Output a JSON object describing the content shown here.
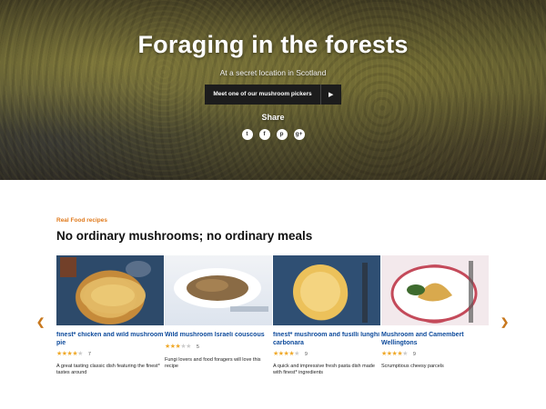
{
  "hero": {
    "title": "Foraging in the forests",
    "subtitle": "At a secret location in Scotland",
    "cta_label": "Meet one of our mushroom pickers",
    "cta_icon": "play-icon",
    "share_label": "Share",
    "share_icons": [
      "twitter-icon",
      "facebook-icon",
      "pinterest-icon",
      "google-plus-icon"
    ]
  },
  "recipes": {
    "eyebrow": "Real Food recipes",
    "title": "No ordinary mushrooms; no ordinary meals",
    "prev_icon": "chevron-left-icon",
    "next_icon": "chevron-right-icon",
    "items": [
      {
        "title": "finest* chicken and wild mushroom pie",
        "rating": 4,
        "rating_count": "7",
        "description": "A great tasting classic dish featuring the finest* tastes around"
      },
      {
        "title": "Wild mushroom Israeli couscous",
        "rating": 3,
        "rating_count": "5",
        "description": "Fungi lovers and food foragers will love this recipe"
      },
      {
        "title": "finest* mushroom and fusilli lunghi carbonara",
        "rating": 4,
        "rating_count": "9",
        "description": "A quick and impressive fresh pasta dish made with finest* ingredients"
      },
      {
        "title": "Mushroom and Camembert Wellingtons",
        "rating": 4,
        "rating_count": "9",
        "description": "Scrumptious cheesy parcels"
      }
    ]
  },
  "colors": {
    "accent": "#e07a1c",
    "link": "#0d4a9b",
    "star": "#f0a92a",
    "cta_bg": "#1c1c1c"
  }
}
